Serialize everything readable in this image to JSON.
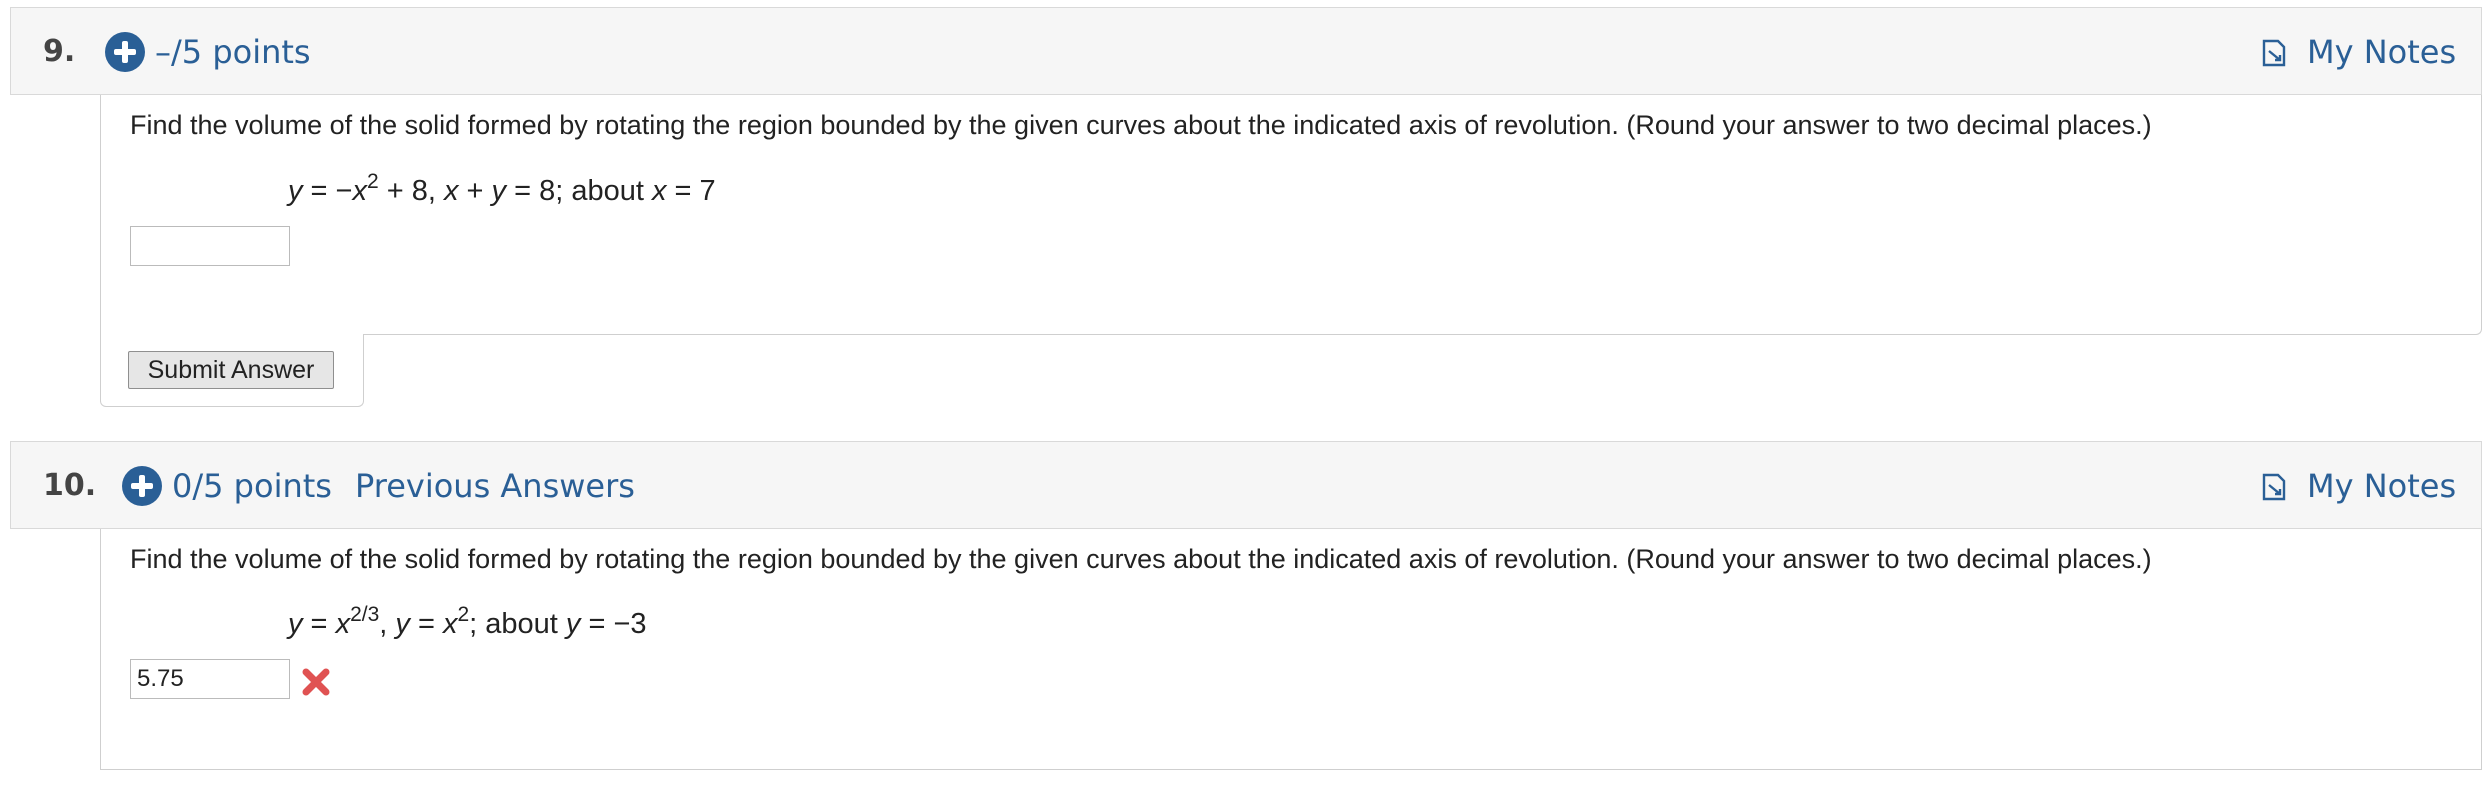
{
  "questions": [
    {
      "number": "9.",
      "points": "–/5 points",
      "notes_label": "My Notes",
      "prompt": "Find the volume of the solid formed by rotating the region bounded by the given curves about the indicated axis of revolution. (Round your answer to two decimal places.)",
      "answer_value": "",
      "submit_label": "Submit Answer"
    },
    {
      "number": "10.",
      "points": "0/5 points",
      "previous_answers_label": "Previous Answers",
      "notes_label": "My Notes",
      "prompt": "Find the volume of the solid formed by rotating the region bounded by the given curves about the indicated axis of revolution. (Round your answer to two decimal places.)",
      "answer_value": "5.75",
      "answer_status": "incorrect"
    }
  ],
  "colors": {
    "link": "#2a5f96",
    "header_bg": "#f6f6f6",
    "incorrect": "#e05252"
  },
  "icons": {
    "expand": "plus-circle-icon",
    "notes": "notes-icon",
    "incorrect": "x-mark-icon"
  }
}
